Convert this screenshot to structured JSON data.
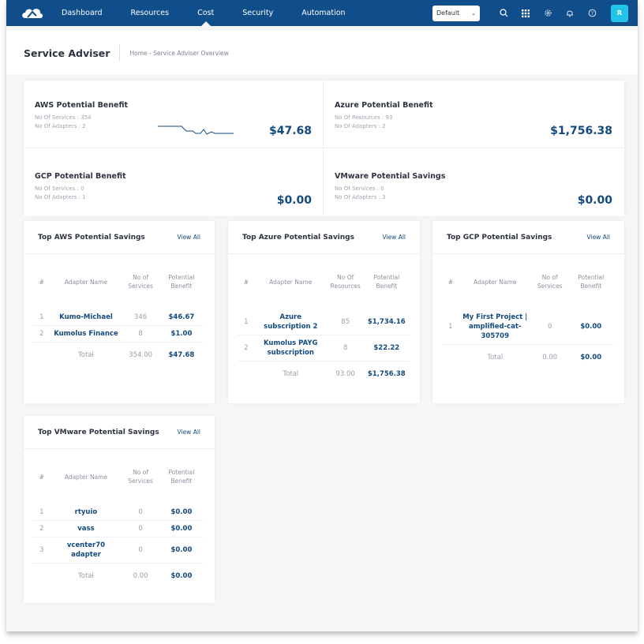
{
  "nav": {
    "items": [
      "Dashboard",
      "Resources",
      "Cost",
      "Security",
      "Automation"
    ],
    "active_index": 2,
    "dropdown_value": "Default",
    "avatar_letter": "R"
  },
  "header": {
    "title": "Service Adviser",
    "breadcrumb": "Home - Service Adviser Overview"
  },
  "summary": [
    {
      "title": "AWS Potential Benefit",
      "line1": "No Of Services : 354",
      "line2": "No Of Adapters : 2",
      "value": "$47.68"
    },
    {
      "title": "Azure Potential Benefit",
      "line1": "No Of Resources : 93",
      "line2": "No Of Adapters : 2",
      "value": "$1,756.38"
    },
    {
      "title": "GCP Potential Benefit",
      "line1": "No Of Services : 0",
      "line2": "No Of Adapters : 1",
      "value": "$0.00"
    },
    {
      "title": "VMware Potential Savings",
      "line1": "No Of Services : 0",
      "line2": "No Of Adapters : 3",
      "value": "$0.00"
    }
  ],
  "panels": {
    "aws": {
      "title": "Top AWS Potential Savings",
      "view_all": "View All",
      "headers": [
        "#",
        "Adapter Name",
        "No of\nServices",
        "Potential\nBenefit"
      ],
      "rows": [
        {
          "idx": "1",
          "name": "Kumo-Michael",
          "count": "346",
          "benefit": "$46.67"
        },
        {
          "idx": "2",
          "name": "Kumolus Finance",
          "count": "8",
          "benefit": "$1.00"
        }
      ],
      "total": {
        "label": "Total",
        "count": "354.00",
        "benefit": "$47.68"
      }
    },
    "azure": {
      "title": "Top Azure Potential Savings",
      "view_all": "View All",
      "headers": [
        "#",
        "Adapter Name",
        "No Of\nResources",
        "Potential\nBenefit"
      ],
      "rows": [
        {
          "idx": "1",
          "name": "Azure subscription 2",
          "count": "85",
          "benefit": "$1,734.16"
        },
        {
          "idx": "2",
          "name": "Kumolus PAYG subscription",
          "count": "8",
          "benefit": "$22.22"
        }
      ],
      "total": {
        "label": "Total",
        "count": "93.00",
        "benefit": "$1,756.38"
      }
    },
    "gcp": {
      "title": "Top GCP Potential Savings",
      "view_all": "View All",
      "headers": [
        "#",
        "Adapter Name",
        "No of\nServices",
        "Potential\nBenefit"
      ],
      "rows": [
        {
          "idx": "1",
          "name": "My First Project | amplified-cat-305709",
          "count": "0",
          "benefit": "$0.00"
        }
      ],
      "total": {
        "label": "Total",
        "count": "0.00",
        "benefit": "$0.00"
      }
    },
    "vmware": {
      "title": "Top VMware Potential Savings",
      "view_all": "View All",
      "headers": [
        "#",
        "Adapter Name",
        "No of\nServices",
        "Potential\nBenefit"
      ],
      "rows": [
        {
          "idx": "1",
          "name": "rtyuio",
          "count": "0",
          "benefit": "$0.00"
        },
        {
          "idx": "2",
          "name": "vass",
          "count": "0",
          "benefit": "$0.00"
        },
        {
          "idx": "3",
          "name": "vcenter70 adapter",
          "count": "0",
          "benefit": "$0.00"
        }
      ],
      "total": {
        "label": "Total",
        "count": "0.00",
        "benefit": "$0.00"
      }
    }
  },
  "icons": [
    "cloud-logo-icon",
    "search-icon",
    "apps-grid-icon",
    "settings-icon",
    "bell-icon",
    "help-icon"
  ],
  "colors": {
    "nav_bg": "#104e8b",
    "accent": "#134a7e",
    "avatar": "#20c4e8"
  }
}
